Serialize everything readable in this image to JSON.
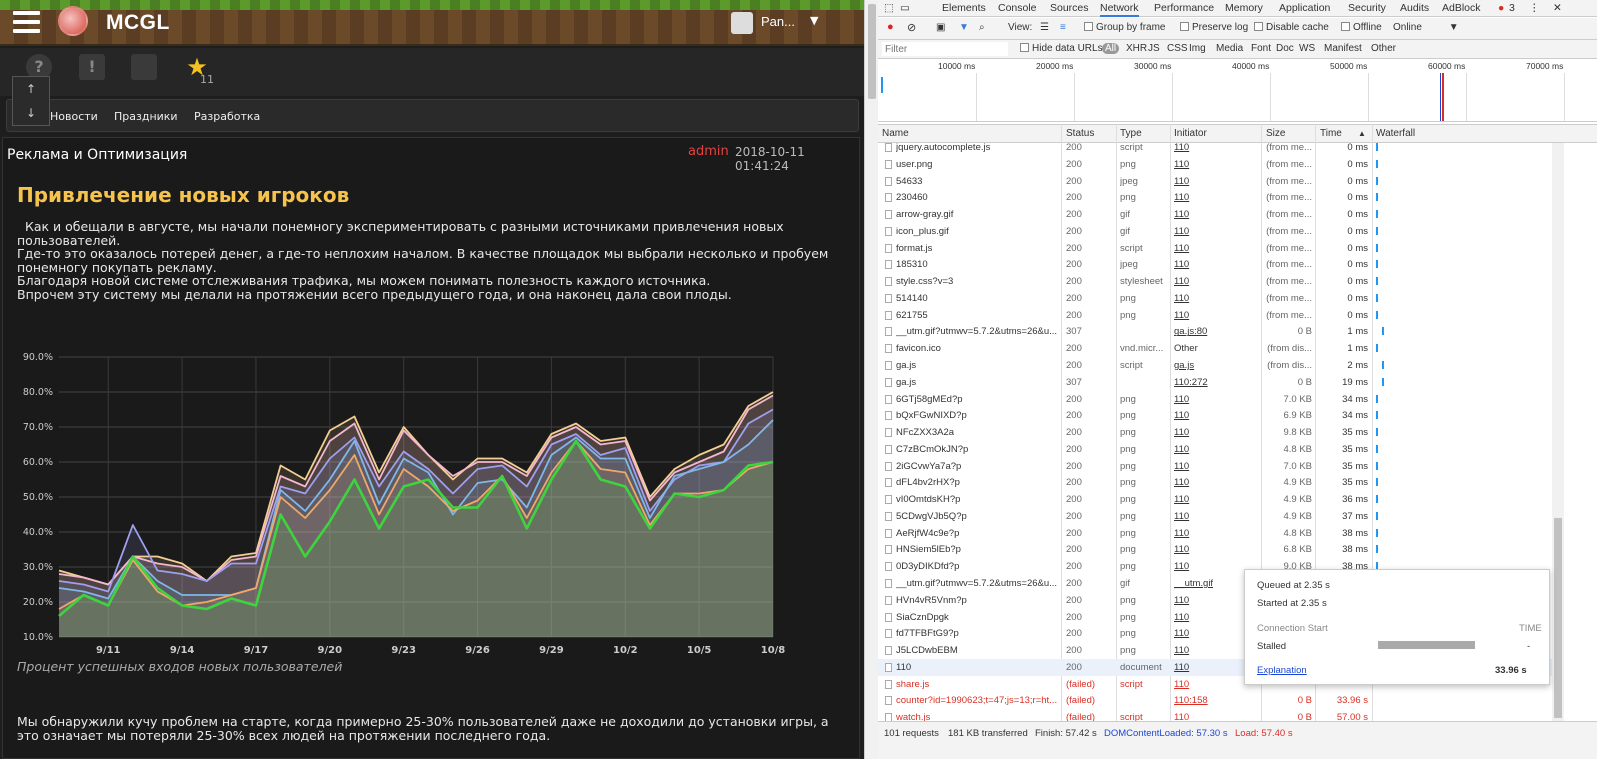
{
  "site": {
    "title": "MCGL",
    "username": "Pan...",
    "user_caret": "▼",
    "star_count": "11",
    "arrow_up": "↑",
    "arrow_down": "↓",
    "icon_help": "?",
    "icon_chat": "!",
    "icon_star": "★",
    "nav": [
      "Новости",
      "Праздники",
      "Разработка"
    ]
  },
  "article": {
    "category": "Реклама и Оптимизация",
    "author": "admin",
    "date": "2018-10-11 01:41:24",
    "headline": "Привлечение новых игроков",
    "intro": [
      "  Как и обещали в августе, мы начали понемногу экспериментировать с разными источниками привлечения новых пользователей.",
      "Где-то это оказалось потерей денег, а где-то неплохим началом. В качестве площадок мы выбрали несколько и пробуем понемногу покупать рекламу.",
      "Благодаря новой системе отслеживания трафика, мы можем понимать полезность каждого источника.",
      "Впрочем эту систему мы делали на протяжении всего предыдущего года, и она наконец дала свои плоды."
    ],
    "caption": "Процент успешных входов новых пользователей",
    "outro": "Мы обнаружили кучу проблем на старте, когда примерно 25-30% пользователей даже не доходили до установки игры, а это означает мы потеряли 25-30% всех людей на протяжении последнего года."
  },
  "chart_data": {
    "type": "area",
    "x_ticks": [
      "9/11",
      "9/14",
      "9/17",
      "9/20",
      "9/23",
      "9/26",
      "9/29",
      "10/2",
      "10/5",
      "10/8"
    ],
    "y_ticks": [
      "10.0%",
      "20.0%",
      "30.0%",
      "40.0%",
      "50.0%",
      "60.0%",
      "70.0%",
      "80.0%",
      "90.0%"
    ],
    "ylim": [
      10,
      90
    ],
    "x_start": "9/9",
    "x_end": "10/8",
    "grid": true,
    "series": [
      {
        "color": "#f2cf92",
        "values": [
          29,
          27,
          25,
          33,
          33,
          31,
          26,
          33,
          34,
          59,
          55,
          69,
          73,
          57,
          70,
          62,
          55,
          61,
          61,
          57,
          68,
          71,
          66,
          67,
          50,
          58,
          62,
          65,
          76,
          80
        ]
      },
      {
        "color": "#f5b6d0",
        "values": [
          28,
          27,
          25,
          33,
          31,
          30,
          26,
          32,
          33,
          56,
          53,
          66,
          71,
          55,
          69,
          62,
          56,
          60,
          60,
          56,
          67,
          70,
          65,
          66,
          49,
          57,
          60,
          63,
          75,
          79
        ]
      },
      {
        "color": "#9f9ff0",
        "values": [
          26,
          25,
          23,
          42,
          29,
          28,
          26,
          31,
          31,
          53,
          51,
          61,
          67,
          53,
          63,
          58,
          51,
          58,
          59,
          53,
          65,
          68,
          62,
          64,
          46,
          55,
          59,
          60,
          71,
          75
        ]
      },
      {
        "color": "#7fb8e8",
        "values": [
          24,
          23,
          21,
          33,
          26,
          22,
          22,
          22,
          24,
          52,
          46,
          55,
          66,
          48,
          61,
          57,
          45,
          54,
          55,
          47,
          62,
          67,
          61,
          61,
          44,
          56,
          58,
          60,
          65,
          72
        ]
      },
      {
        "color": "#f0a866",
        "values": [
          18,
          22,
          19,
          32,
          23,
          19,
          20,
          22,
          24,
          50,
          44,
          52,
          62,
          45,
          58,
          53,
          46,
          49,
          56,
          44,
          57,
          66,
          58,
          57,
          42,
          51,
          51,
          52,
          58,
          60
        ]
      },
      {
        "color": "#3ed43e",
        "values": [
          16,
          22,
          19,
          33,
          24,
          19,
          18,
          21,
          19,
          45,
          33,
          43,
          55,
          41,
          53,
          55,
          47,
          47,
          56,
          41,
          55,
          66,
          55,
          53,
          41,
          51,
          50,
          52,
          59,
          60
        ]
      }
    ]
  },
  "devtools": {
    "tabs": [
      "Elements",
      "Console",
      "Sources",
      "Network",
      "Performance",
      "Memory",
      "Application",
      "Security",
      "Audits",
      "AdBlock"
    ],
    "active_tab": "Network",
    "error_count": "3",
    "toolbar": {
      "view_label": "View:",
      "group_by_frame": "Group by frame",
      "preserve_log": "Preserve log",
      "disable_cache": "Disable cache",
      "offline": "Offline",
      "throttle": "Online"
    },
    "filter": {
      "placeholder": "Filter",
      "hide_data_urls": "Hide data URLs",
      "types": [
        "All",
        "XHR",
        "JS",
        "CSS",
        "Img",
        "Media",
        "Font",
        "Doc",
        "WS",
        "Manifest",
        "Other"
      ]
    },
    "overview_ticks": [
      "10000 ms",
      "20000 ms",
      "30000 ms",
      "40000 ms",
      "50000 ms",
      "60000 ms",
      "70000 ms"
    ],
    "columns": [
      "Name",
      "Status",
      "Type",
      "Initiator",
      "Size",
      "Time",
      "Waterfall"
    ],
    "sort_indicator": "▲",
    "rows": [
      {
        "name": "jquery.autocomplete.js",
        "status": "200",
        "type": "script",
        "initiator": "110",
        "size": "(from me...",
        "time": "0 ms"
      },
      {
        "name": "user.png",
        "status": "200",
        "type": "png",
        "initiator": "110",
        "size": "(from me...",
        "time": "0 ms"
      },
      {
        "name": "54633",
        "status": "200",
        "type": "jpeg",
        "initiator": "110",
        "size": "(from me...",
        "time": "0 ms"
      },
      {
        "name": "230460",
        "status": "200",
        "type": "png",
        "initiator": "110",
        "size": "(from me...",
        "time": "0 ms"
      },
      {
        "name": "arrow-gray.gif",
        "status": "200",
        "type": "gif",
        "initiator": "110",
        "size": "(from me...",
        "time": "0 ms"
      },
      {
        "name": "icon_plus.gif",
        "status": "200",
        "type": "gif",
        "initiator": "110",
        "size": "(from me...",
        "time": "0 ms"
      },
      {
        "name": "format.js",
        "status": "200",
        "type": "script",
        "initiator": "110",
        "size": "(from me...",
        "time": "0 ms"
      },
      {
        "name": "185310",
        "status": "200",
        "type": "jpeg",
        "initiator": "110",
        "size": "(from me...",
        "time": "0 ms"
      },
      {
        "name": "style.css?v=3",
        "status": "200",
        "type": "stylesheet",
        "initiator": "110",
        "size": "(from me...",
        "time": "0 ms"
      },
      {
        "name": "514140",
        "status": "200",
        "type": "png",
        "initiator": "110",
        "size": "(from me...",
        "time": "0 ms"
      },
      {
        "name": "621755",
        "status": "200",
        "type": "png",
        "initiator": "110",
        "size": "(from me...",
        "time": "0 ms"
      },
      {
        "name": "__utm.gif?utmwv=5.7.2&utms=26&u...",
        "status": "307",
        "type": "",
        "initiator": "ga.js:80",
        "size": "0 B",
        "time": "1 ms"
      },
      {
        "name": "favicon.ico",
        "status": "200",
        "type": "vnd.micr...",
        "initiator": "Other",
        "size": "(from dis...",
        "time": "1 ms"
      },
      {
        "name": "ga.js",
        "status": "200",
        "type": "script",
        "initiator": "ga.js",
        "size": "(from dis...",
        "time": "2 ms"
      },
      {
        "name": "ga.js",
        "status": "307",
        "type": "",
        "initiator": "110:272",
        "size": "0 B",
        "time": "19 ms"
      },
      {
        "name": "6GTj58gMEd?p",
        "status": "200",
        "type": "png",
        "initiator": "110",
        "size": "7.0 KB",
        "time": "34 ms"
      },
      {
        "name": "bQxFGwNIXD?p",
        "status": "200",
        "type": "png",
        "initiator": "110",
        "size": "6.9 KB",
        "time": "34 ms"
      },
      {
        "name": "NFcZXX3A2a",
        "status": "200",
        "type": "png",
        "initiator": "110",
        "size": "9.8 KB",
        "time": "35 ms"
      },
      {
        "name": "C7zBCmOkJN?p",
        "status": "200",
        "type": "png",
        "initiator": "110",
        "size": "4.8 KB",
        "time": "35 ms"
      },
      {
        "name": "2iGCvwYa7a?p",
        "status": "200",
        "type": "png",
        "initiator": "110",
        "size": "7.0 KB",
        "time": "35 ms"
      },
      {
        "name": "dFL4bv2rHX?p",
        "status": "200",
        "type": "png",
        "initiator": "110",
        "size": "4.9 KB",
        "time": "35 ms"
      },
      {
        "name": "vI0OmtdsKH?p",
        "status": "200",
        "type": "png",
        "initiator": "110",
        "size": "4.9 KB",
        "time": "36 ms"
      },
      {
        "name": "5CDwgVJb5Q?p",
        "status": "200",
        "type": "png",
        "initiator": "110",
        "size": "4.9 KB",
        "time": "37 ms"
      },
      {
        "name": "AeRjfW4c9e?p",
        "status": "200",
        "type": "png",
        "initiator": "110",
        "size": "4.8 KB",
        "time": "38 ms"
      },
      {
        "name": "HNSiem5lEb?p",
        "status": "200",
        "type": "png",
        "initiator": "110",
        "size": "6.8 KB",
        "time": "38 ms"
      },
      {
        "name": "0D3yDIKDfd?p",
        "status": "200",
        "type": "png",
        "initiator": "110",
        "size": "9.0 KB",
        "time": "38 ms"
      },
      {
        "name": "__utm.gif?utmwv=5.7.2&utms=26&u...",
        "status": "200",
        "type": "gif",
        "initiator": "__utm.gif",
        "size": "",
        "time": ""
      },
      {
        "name": "HVn4vR5Vnm?p",
        "status": "200",
        "type": "png",
        "initiator": "110",
        "size": "",
        "time": ""
      },
      {
        "name": "SiaCznDpgk",
        "status": "200",
        "type": "png",
        "initiator": "110",
        "size": "",
        "time": ""
      },
      {
        "name": "fd7TFBFtG9?p",
        "status": "200",
        "type": "png",
        "initiator": "110",
        "size": "",
        "time": ""
      },
      {
        "name": "J5LCDwbEBM",
        "status": "200",
        "type": "png",
        "initiator": "110",
        "size": "",
        "time": ""
      },
      {
        "name": "110",
        "status": "200",
        "type": "document",
        "initiator": "110",
        "size": "",
        "time": "",
        "selected": true
      },
      {
        "name": "share.js",
        "status": "(failed)",
        "type": "script",
        "initiator": "110",
        "size": "",
        "time": "",
        "failed": true
      },
      {
        "name": "counter?id=1990623;t=47;js=13;r=ht...",
        "status": "(failed)",
        "type": "",
        "initiator": "110:158",
        "size": "0 B",
        "time": "33.96 s",
        "failed": true
      },
      {
        "name": "watch.js",
        "status": "(failed)",
        "type": "script",
        "initiator": "110",
        "size": "0 B",
        "time": "57.00 s",
        "failed": true
      }
    ],
    "tooltip": {
      "queued": "Queued at 2.35 s",
      "started": "Started at 2.35 s",
      "section": "Connection Start",
      "section_right": "TIME",
      "stalled_label": "Stalled",
      "stalled_value": "-",
      "explanation": "Explanation",
      "total": "33.96 s"
    },
    "status": {
      "requests": "101 requests",
      "transferred": "181 KB transferred",
      "finish": "Finish: 57.42 s",
      "dcl": "DOMContentLoaded: 57.30 s",
      "load": "Load: 57.40 s"
    },
    "colors": {
      "accent": "#3879d9",
      "failed": "#d93025",
      "dcl": "#1a47d8",
      "load": "#d92c2c"
    }
  }
}
